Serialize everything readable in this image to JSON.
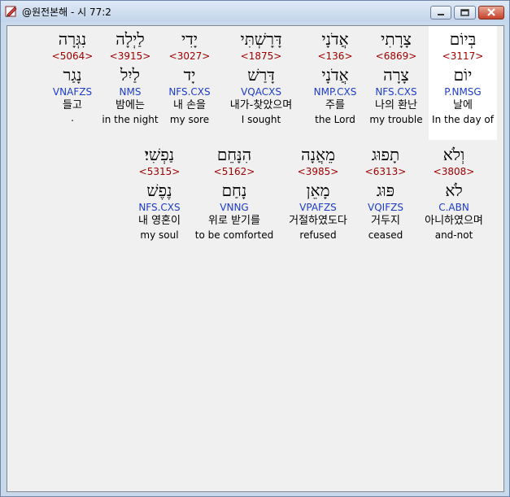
{
  "window": {
    "title": "@원전본해 - 시 77:2",
    "app_icon": "pen-book-icon",
    "controls": [
      "minimize-icon",
      "maximize-icon",
      "close-icon"
    ]
  },
  "rows": [
    [
      {
        "heb": "בְּיוֹם",
        "strong": "<3117>",
        "lemma": "יוֹם",
        "morph": "P.NMSG",
        "kor": "날에",
        "eng": "In the day of",
        "highlighted": true
      },
      {
        "heb": "צָרָתִי",
        "strong": "<6869>",
        "lemma": "צָרָה",
        "morph": "NFS.CXS",
        "kor": "나의 환난",
        "eng": "my trouble"
      },
      {
        "heb": "אֲדֹנָי",
        "strong": "<136>",
        "lemma": "אֲדֹנָי",
        "morph": "NMP.CXS",
        "kor": "주를",
        "eng": "the Lord"
      },
      {
        "heb": "דָּרָשְׁתִּי",
        "strong": "<1875>",
        "lemma": "דָּרַשׁ",
        "morph": "VQACXS",
        "kor": "내가-찾았으며",
        "eng": "I sought"
      },
      {
        "heb": "יָדִי",
        "strong": "<3027>",
        "lemma": "יָד",
        "morph": "NFS.CXS",
        "kor": "내 손을",
        "eng": "my sore"
      },
      {
        "heb": "לַיְלָה",
        "strong": "<3915>",
        "lemma": "לַיִל",
        "morph": "NMS",
        "kor": "밤에는",
        "eng": "in the night"
      },
      {
        "heb": "נִגְּרָה",
        "strong": "<5064>",
        "lemma": "נָגַר",
        "morph": "VNAFZS",
        "kor": "들고",
        "eng": "",
        "extra": "."
      }
    ],
    [
      {
        "heb": "וְלֹא",
        "strong": "<3808>",
        "lemma": "לֹא",
        "morph": "C.ABN",
        "kor": "아니하였으며",
        "eng": "and-not"
      },
      {
        "heb": "תָפוּג",
        "strong": "<6313>",
        "lemma": "פּוּג",
        "morph": "VQIFZS",
        "kor": "거두지",
        "eng": "ceased"
      },
      {
        "heb": "מֵאֲנָה",
        "strong": "<3985>",
        "lemma": "מָאֵן",
        "morph": "VPAFZS",
        "kor": "거절하였도다",
        "eng": "refused"
      },
      {
        "heb": "הִנָּחֵם",
        "strong": "<5162>",
        "lemma": "נָחַם",
        "morph": "VNNG",
        "kor": "위로 받기를",
        "eng": "to be comforted"
      },
      {
        "heb": "נַפְשִׁי׃",
        "strong": "<5315>",
        "lemma": "נֶפֶשׁ",
        "morph": "NFS.CXS",
        "kor": "내 영혼이",
        "eng": "my soul"
      }
    ]
  ]
}
